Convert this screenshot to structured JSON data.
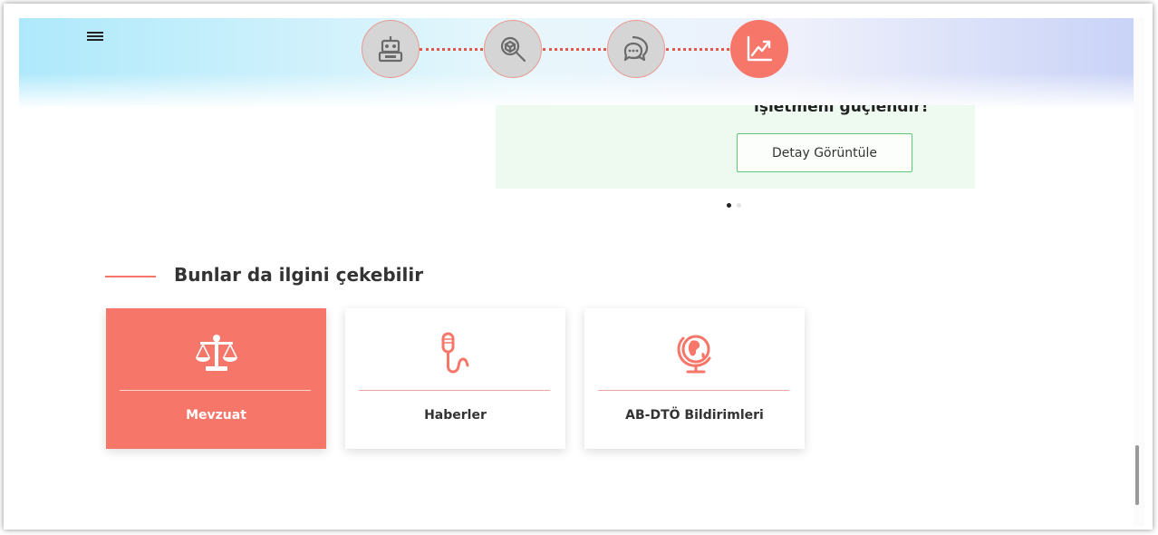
{
  "header": {
    "menu_icon": "hamburger-menu-icon",
    "steps": [
      {
        "icon": "robot-icon",
        "active": false
      },
      {
        "icon": "box-search-icon",
        "active": false
      },
      {
        "icon": "chat-bubbles-icon",
        "active": false
      },
      {
        "icon": "trend-chart-icon",
        "active": true
      }
    ]
  },
  "promo": {
    "heading": "işletmeni güçlendir!",
    "button_label": "Detay Görüntüle",
    "pager": {
      "current": 1,
      "total": 2
    }
  },
  "related": {
    "title": "Bunlar da ilgini çekebilir",
    "cards": [
      {
        "label": "Mevzuat",
        "icon": "scales-icon",
        "active": true
      },
      {
        "label": "Haberler",
        "icon": "microphone-icon",
        "active": false
      },
      {
        "label": "AB-DTÖ Bildirimleri",
        "icon": "globe-icon",
        "active": false
      }
    ]
  },
  "colors": {
    "accent": "#f7766a",
    "promo_bg": "#eef9ef",
    "button_border": "#5ec978",
    "inactive_step": "#d5d5d5"
  }
}
